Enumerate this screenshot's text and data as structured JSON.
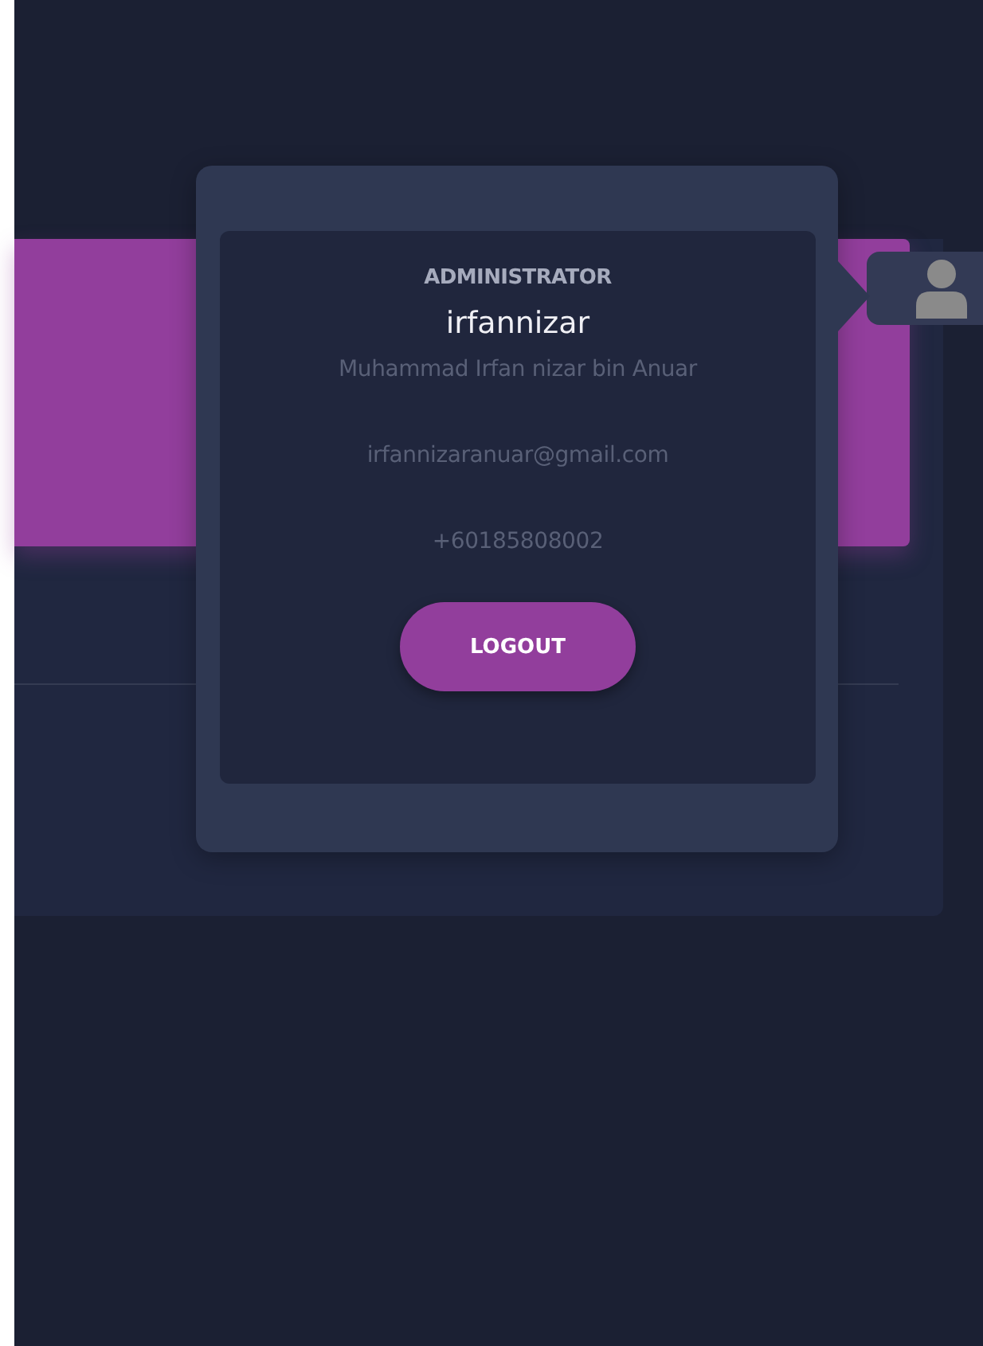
{
  "profile_popup": {
    "role": "ADMINISTRATOR",
    "username": "irfannizar",
    "full_name": "Muhammad Irfan nizar bin Anuar",
    "email": "irfannizaranuar@gmail.com",
    "phone": "+60185808002",
    "logout_button": "LOGOUT"
  }
}
